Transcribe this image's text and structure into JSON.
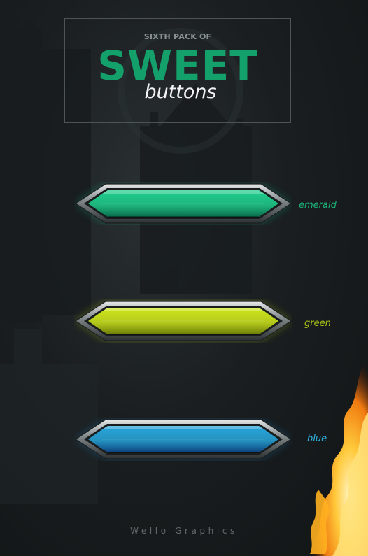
{
  "header": {
    "kicker": "SIXTH PACK OF",
    "title": "SWEET",
    "subtitle": "buttons"
  },
  "buttons": [
    {
      "label": "emerald",
      "label_color": "#1bb47a",
      "fill_top": "#1fd08e",
      "fill_bottom": "#0a6a4a",
      "glow": "#16c081"
    },
    {
      "label": "green",
      "label_color": "#a8c413",
      "fill_top": "#cfe81c",
      "fill_bottom": "#6a7a06",
      "glow": "#b6d414"
    },
    {
      "label": "blue",
      "label_color": "#2fb7e6",
      "fill_top": "#27a6dc",
      "fill_bottom": "#0c3f7a",
      "glow": "#1a86c8"
    }
  ],
  "footer": "Wello Graphics",
  "colors": {
    "background": "#1a1e20",
    "title_accent": "#13a06a",
    "frame_metal": "#9aa0a2"
  }
}
